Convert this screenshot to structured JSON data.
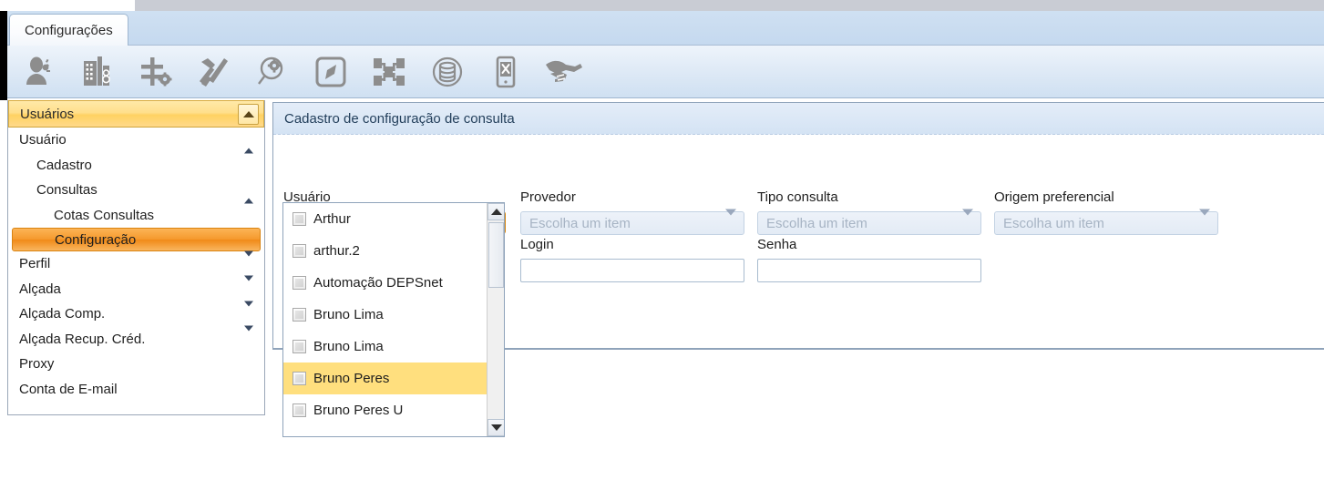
{
  "tab": {
    "label": "Configurações"
  },
  "toolbar": {
    "buttons": [
      {
        "icon": "user-config-icon",
        "name": "toolbar-usuarios"
      },
      {
        "icon": "building-icon",
        "name": "toolbar-empresas"
      },
      {
        "icon": "currency-gear-icon",
        "name": "toolbar-financeiro"
      },
      {
        "icon": "hammer-wrench-icon",
        "name": "toolbar-ferramentas"
      },
      {
        "icon": "magnifier-gear-icon",
        "name": "toolbar-consultas"
      },
      {
        "icon": "compass-icon",
        "name": "toolbar-navegacao"
      },
      {
        "icon": "workflow-documents-icon",
        "name": "toolbar-fluxo"
      },
      {
        "icon": "database-icon",
        "name": "toolbar-banco-dados"
      },
      {
        "icon": "mobile-tools-icon",
        "name": "toolbar-mobile"
      },
      {
        "icon": "handshake-icon",
        "name": "toolbar-parcerias"
      }
    ]
  },
  "sidebar": {
    "header": {
      "label": "Usuários",
      "collapse_icon": "chevron-up-icon"
    },
    "items": [
      {
        "label": "Usuário",
        "level": 0,
        "caret": "up",
        "selected": false
      },
      {
        "label": "Cadastro",
        "level": 1,
        "caret": "",
        "selected": false
      },
      {
        "label": "Consultas",
        "level": 1,
        "caret": "up",
        "selected": false
      },
      {
        "label": "Cotas Consultas",
        "level": 2,
        "caret": "",
        "selected": false
      },
      {
        "label": "Configuração",
        "level": 2,
        "caret": "",
        "selected": true
      },
      {
        "label": "Perfil",
        "level": 0,
        "caret": "down",
        "selected": false
      },
      {
        "label": "Alçada",
        "level": 0,
        "caret": "down",
        "selected": false
      },
      {
        "label": "Alçada Comp.",
        "level": 0,
        "caret": "down",
        "selected": false
      },
      {
        "label": "Alçada Recup. Créd.",
        "level": 0,
        "caret": "down",
        "selected": false
      },
      {
        "label": "Proxy",
        "level": 0,
        "caret": "",
        "selected": false
      },
      {
        "label": "Conta de E-mail",
        "level": 0,
        "caret": "",
        "selected": false
      }
    ]
  },
  "panel": {
    "title": "Cadastro de configuração de consulta",
    "fields": {
      "usuario_label": "Usuário",
      "provedor_label": "Provedor",
      "provedor_value": "Escolha um item",
      "tipo_consulta_label": "Tipo consulta",
      "tipo_consulta_value": "Escolha um item",
      "origem_label": "Origem preferencial",
      "origem_value": "Escolha um item",
      "login_label": "Login",
      "login_value": "",
      "senha_label": "Senha",
      "senha_value": ""
    },
    "user_dropdown": {
      "selected_text": "",
      "open": true,
      "options": [
        {
          "label": "Arthur",
          "checked": false,
          "highlighted": false
        },
        {
          "label": "arthur.2",
          "checked": false,
          "highlighted": false
        },
        {
          "label": "Automação DEPSnet",
          "checked": false,
          "highlighted": false
        },
        {
          "label": "Bruno Lima",
          "checked": false,
          "highlighted": false
        },
        {
          "label": "Bruno Lima",
          "checked": false,
          "highlighted": false
        },
        {
          "label": "Bruno Peres",
          "checked": false,
          "highlighted": true
        },
        {
          "label": "Bruno Peres U",
          "checked": false,
          "highlighted": false
        }
      ]
    }
  },
  "colors": {
    "accent_orange": "#f28c12",
    "header_yellow": "#ffd262",
    "highlight_yellow": "#ffdf7e",
    "tab_blue": "#cfe0f2",
    "panel_border": "#8fa3ba"
  }
}
